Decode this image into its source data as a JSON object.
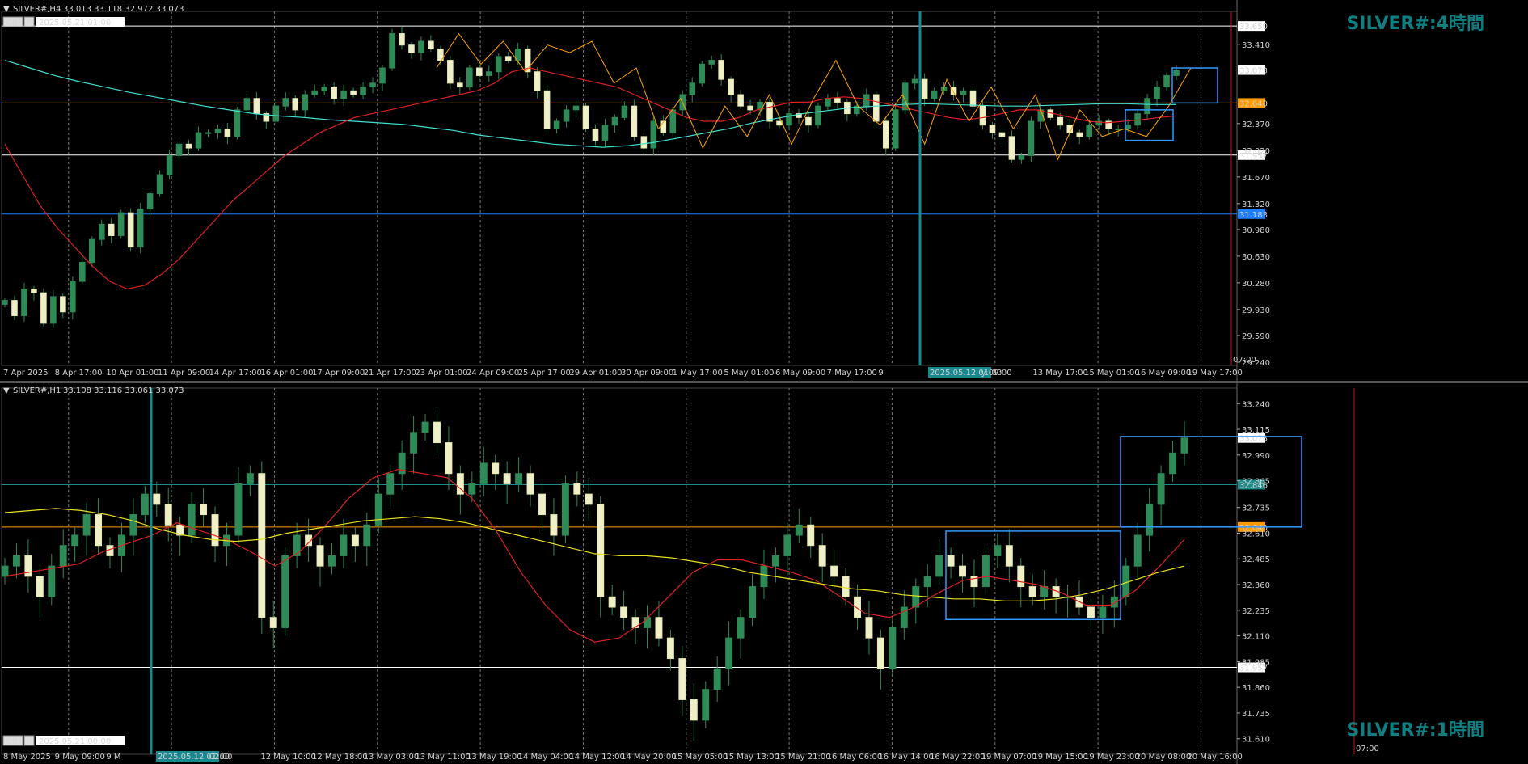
{
  "chart_data": [
    {
      "type": "candlestick",
      "symbol": "SILVER#,H4",
      "ohlc": "33.013 33.118 32.972 33.073",
      "title": "SILVER#:4時間",
      "date_box": "2025.05.21 01:00",
      "ylim": [
        29.24,
        33.8
      ],
      "price_ticks": [
        "33.650",
        "33.410",
        "33.073",
        "32.640",
        "32.370",
        "32.020",
        "31.957",
        "31.670",
        "31.320",
        "31.183",
        "30.980",
        "30.630",
        "30.280",
        "29.930",
        "29.590",
        "29.240"
      ],
      "current_price": "33.073",
      "hlines": [
        {
          "price": "33.650",
          "color": "#ffffff"
        },
        {
          "price": "32.640",
          "color": "#ff9a00"
        },
        {
          "price": "31.957",
          "color": "#ffffff"
        },
        {
          "price": "31.183",
          "color": "#1e7fff"
        }
      ],
      "x_labels": [
        "7 Apr 2025",
        "8 Apr 17:00",
        "10 Apr 01:00",
        "11 Apr 09:00",
        "14 Apr 17:00",
        "16 Apr 01:00",
        "17 Apr 09:00",
        "21 Apr 17:00",
        "23 Apr 01:00",
        "24 Apr 09:00",
        "25 Apr 17:00",
        "29 Apr 01:00",
        "30 Apr 09:00",
        "1 May 17:00",
        "5 May 01:00",
        "6 May 09:00",
        "7 May 17:00",
        "9",
        "2025.05.12 01:00",
        "y 09:00",
        "13 May 17:00",
        "15 May 01:00",
        "16 May 09:00",
        "19 May 17:00"
      ],
      "vline_label": "07:00",
      "closes": [
        30.05,
        29.85,
        30.2,
        30.15,
        29.75,
        30.1,
        29.9,
        30.3,
        30.55,
        30.85,
        31.05,
        30.9,
        31.2,
        30.75,
        31.25,
        31.45,
        31.7,
        31.95,
        32.1,
        32.05,
        32.25,
        32.25,
        32.3,
        32.2,
        32.55,
        32.7,
        32.5,
        32.4,
        32.6,
        32.7,
        32.55,
        32.75,
        32.8,
        32.85,
        32.7,
        32.8,
        32.75,
        32.85,
        32.9,
        33.1,
        33.55,
        33.4,
        33.3,
        33.45,
        33.35,
        33.2,
        32.9,
        32.85,
        33.1,
        33.0,
        33.05,
        33.25,
        33.2,
        33.35,
        33.05,
        32.8,
        32.3,
        32.4,
        32.55,
        32.6,
        32.3,
        32.15,
        32.35,
        32.45,
        32.6,
        32.2,
        32.05,
        32.4,
        32.25,
        32.55,
        32.75,
        32.9,
        33.15,
        33.2,
        32.95,
        32.75,
        32.6,
        32.55,
        32.65,
        32.4,
        32.35,
        32.5,
        32.45,
        32.35,
        32.6,
        32.7,
        32.65,
        32.5,
        32.6,
        32.75,
        32.4,
        32.05,
        32.55,
        32.9,
        32.95,
        32.7,
        32.8,
        32.85,
        32.75,
        32.8,
        32.6,
        32.35,
        32.25,
        32.2,
        31.9,
        31.95,
        32.4,
        32.55,
        32.45,
        32.35,
        32.25,
        32.2,
        32.35,
        32.4,
        32.3,
        32.3,
        32.35,
        32.5,
        32.7,
        32.85,
        33.0,
        33.073
      ],
      "ma_red": [
        32.1,
        31.7,
        31.3,
        31.0,
        30.75,
        30.5,
        30.3,
        30.2,
        30.25,
        30.4,
        30.6,
        30.85,
        31.1,
        31.35,
        31.55,
        31.75,
        31.95,
        32.1,
        32.25,
        32.35,
        32.45,
        32.5,
        32.55,
        32.6,
        32.65,
        32.7,
        32.75,
        32.8,
        32.9,
        33.05,
        33.1,
        33.05,
        33.0,
        32.95,
        32.9,
        32.85,
        32.75,
        32.65,
        32.55,
        32.45,
        32.4,
        32.4,
        32.45,
        32.55,
        32.6,
        32.65,
        32.65,
        32.7,
        32.72,
        32.7,
        32.65,
        32.6,
        32.55,
        32.5,
        32.45,
        32.42,
        32.45,
        32.5,
        32.55,
        32.55,
        32.5,
        32.45,
        32.4,
        32.38,
        32.4,
        32.42,
        32.45,
        32.47
      ],
      "ma_cyan": [
        33.2,
        33.1,
        33.0,
        32.92,
        32.85,
        32.78,
        32.72,
        32.66,
        32.6,
        32.55,
        32.5,
        32.47,
        32.45,
        32.42,
        32.4,
        32.38,
        32.36,
        32.32,
        32.28,
        32.22,
        32.18,
        32.14,
        32.1,
        32.08,
        32.06,
        32.08,
        32.12,
        32.18,
        32.24,
        32.3,
        32.38,
        32.44,
        32.5,
        32.54,
        32.58,
        32.6,
        32.62,
        32.63,
        32.62,
        32.61,
        32.6,
        32.6,
        32.61,
        32.62,
        32.63,
        32.63,
        32.62,
        32.62
      ],
      "zigzag": [
        33.1,
        33.55,
        33.15,
        33.45,
        33.05,
        33.4,
        33.3,
        33.45,
        32.9,
        33.1,
        32.3,
        32.7,
        32.05,
        32.6,
        32.2,
        32.75,
        32.1,
        32.7,
        33.2,
        32.6,
        32.35,
        32.75,
        32.1,
        32.95,
        32.4,
        32.85,
        32.3,
        32.75,
        31.9,
        32.55,
        32.2,
        32.3,
        32.2,
        32.6,
        33.1
      ],
      "rect1": {
        "price_top": 32.55,
        "price_bottom": 32.15
      },
      "rect2": {
        "price_top": 33.1,
        "price_bottom": 32.64
      }
    },
    {
      "type": "candlestick",
      "symbol": "SILVER#,H1",
      "ohlc": "33.108 33.116 33.061 33.073",
      "title": "SILVER#:1時間",
      "date_box": "2025.05.21 00:00",
      "ylim": [
        31.55,
        33.3
      ],
      "price_ticks": [
        "33.240",
        "33.115",
        "33.073",
        "32.990",
        "32.865",
        "32.846",
        "32.735",
        "32.640",
        "32.610",
        "32.485",
        "32.360",
        "32.235",
        "32.110",
        "31.985",
        "31.957",
        "31.860",
        "31.735",
        "31.610"
      ],
      "current_price": "33.073",
      "hlines": [
        {
          "price": "32.846",
          "color": "#1a8a8a"
        },
        {
          "price": "32.640",
          "color": "#ff9a00"
        },
        {
          "price": "31.957",
          "color": "#ffffff"
        }
      ],
      "x_labels": [
        "8 May 2025",
        "9 May 09:00",
        "9 M",
        "2025.05.12 01:00",
        "02:00",
        "12 May 10:00",
        "12 May 18:00",
        "13 May 03:00",
        "13 May 11:00",
        "13 May 19:00",
        "14 May 04:00",
        "14 May 12:00",
        "14 May 20:00",
        "15 May 05:00",
        "15 May 13:00",
        "15 May 21:00",
        "16 May 06:00",
        "16 May 14:00",
        "16 May 22:00",
        "19 May 07:00",
        "19 May 15:00",
        "19 May 23:00",
        "20 May 08:00",
        "20 May 16:00"
      ],
      "vline_label": "07:00",
      "closes": [
        32.45,
        32.5,
        32.4,
        32.3,
        32.45,
        32.55,
        32.6,
        32.7,
        32.55,
        32.5,
        32.6,
        32.7,
        32.8,
        32.75,
        32.65,
        32.6,
        32.75,
        32.7,
        32.55,
        32.6,
        32.85,
        32.9,
        32.2,
        32.15,
        32.5,
        32.6,
        32.55,
        32.45,
        32.5,
        32.6,
        32.55,
        32.65,
        32.8,
        32.9,
        33.0,
        33.1,
        33.15,
        33.05,
        32.9,
        32.8,
        32.85,
        32.95,
        32.9,
        32.85,
        32.9,
        32.8,
        32.7,
        32.6,
        32.85,
        32.8,
        32.75,
        32.3,
        32.25,
        32.2,
        32.15,
        32.2,
        32.1,
        32.0,
        31.8,
        31.7,
        31.85,
        31.95,
        32.1,
        32.2,
        32.35,
        32.45,
        32.5,
        32.6,
        32.65,
        32.55,
        32.45,
        32.4,
        32.3,
        32.2,
        32.1,
        31.95,
        32.15,
        32.25,
        32.35,
        32.4,
        32.5,
        32.45,
        32.4,
        32.35,
        32.5,
        32.55,
        32.45,
        32.35,
        32.3,
        32.35,
        32.3,
        32.3,
        32.25,
        32.2,
        32.25,
        32.3,
        32.45,
        32.6,
        32.75,
        32.9,
        33.0,
        33.073
      ],
      "ma_red": [
        32.4,
        32.42,
        32.44,
        32.46,
        32.52,
        32.56,
        32.6,
        32.66,
        32.62,
        32.58,
        32.52,
        32.45,
        32.52,
        32.64,
        32.78,
        32.88,
        32.92,
        32.9,
        32.88,
        32.78,
        32.62,
        32.42,
        32.26,
        32.14,
        32.08,
        32.1,
        32.18,
        32.3,
        32.42,
        32.48,
        32.48,
        32.45,
        32.42,
        32.38,
        32.3,
        32.22,
        32.2,
        32.25,
        32.32,
        32.38,
        32.4,
        32.38,
        32.36,
        32.32,
        32.26,
        32.26,
        32.33,
        32.45,
        32.58
      ],
      "ma_yellow": [
        32.71,
        32.72,
        32.73,
        32.72,
        32.7,
        32.67,
        32.63,
        32.6,
        32.58,
        32.57,
        32.58,
        32.61,
        32.63,
        32.65,
        32.67,
        32.68,
        32.69,
        32.68,
        32.66,
        32.63,
        32.6,
        32.57,
        32.54,
        32.51,
        32.5,
        32.5,
        32.49,
        32.47,
        32.45,
        32.42,
        32.4,
        32.38,
        32.36,
        32.34,
        32.33,
        32.31,
        32.3,
        32.29,
        32.29,
        32.28,
        32.28,
        32.29,
        32.31,
        32.34,
        32.38,
        32.42,
        32.45
      ],
      "rect1": {
        "price_top": 32.62,
        "price_bottom": 32.19
      },
      "rect2": {
        "price_top": 33.08,
        "price_bottom": 32.64
      }
    }
  ]
}
